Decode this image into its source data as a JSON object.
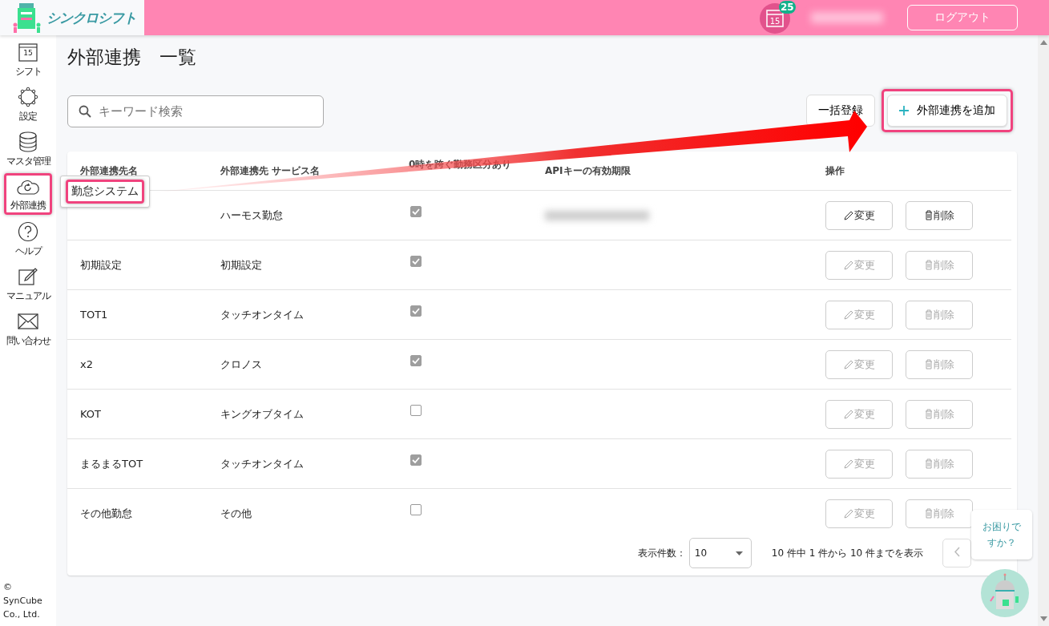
{
  "header": {
    "logo_text": "シンクロシフト",
    "calendar_day": "15",
    "notification_count": "25",
    "user_redacted": true,
    "logout": "ログアウト"
  },
  "sidebar": {
    "items": [
      {
        "kind": "calendar",
        "label": "シフト",
        "day": "15",
        "selected": false
      },
      {
        "kind": "gear",
        "label": "設定",
        "selected": false
      },
      {
        "kind": "database",
        "label": "マスタ管理",
        "selected": false
      },
      {
        "kind": "cloud",
        "label": "外部連携",
        "selected": true,
        "tooltip": "勤怠システム"
      },
      {
        "kind": "help",
        "label": "ヘルプ",
        "selected": false
      },
      {
        "kind": "note",
        "label": "マニュアル",
        "selected": false
      },
      {
        "kind": "mail",
        "label": "問い合わせ",
        "selected": false
      }
    ],
    "copyright": "© SynCube Co., Ltd."
  },
  "page": {
    "title": "外部連携　一覧",
    "search": {
      "placeholder": "キーワード検索"
    },
    "bulk_button": "一括登録",
    "add_button": "外部連携を追加"
  },
  "table": {
    "columns": [
      "外部連携先名",
      "外部連携先 サービス名",
      "0時を跨ぐ勤務区分あり",
      "APIキーの有効期限",
      "操作"
    ],
    "rows": [
      {
        "service": "ハーモス勤怠",
        "checked": true,
        "api_redacted": true,
        "edit": "変更",
        "delete": "削除",
        "disabled": false
      },
      {
        "name": "初期設定",
        "service": "初期設定",
        "checked": true,
        "edit": "変更",
        "delete": "削除",
        "disabled": true
      },
      {
        "name": "TOT1",
        "service": "タッチオンタイム",
        "checked": true,
        "edit": "変更",
        "delete": "削除",
        "disabled": true
      },
      {
        "name": "x2",
        "service": "クロノス",
        "checked": true,
        "edit": "変更",
        "delete": "削除",
        "disabled": true
      },
      {
        "name": "KOT",
        "service": "キングオブタイム",
        "checked": false,
        "edit": "変更",
        "delete": "削除",
        "disabled": true
      },
      {
        "name": "まるまるTOT",
        "service": "タッチオンタイム",
        "checked": true,
        "edit": "変更",
        "delete": "削除",
        "disabled": true
      },
      {
        "name": "その他勤怠",
        "service": "その他",
        "checked": false,
        "edit": "変更",
        "delete": "削除",
        "disabled": true
      }
    ],
    "footer": {
      "per_page_label": "表示件数：",
      "per_page": "10",
      "summary": "10 件中 1 件から 10 件までを表示"
    }
  },
  "help_bubble": "お困りですか？"
}
